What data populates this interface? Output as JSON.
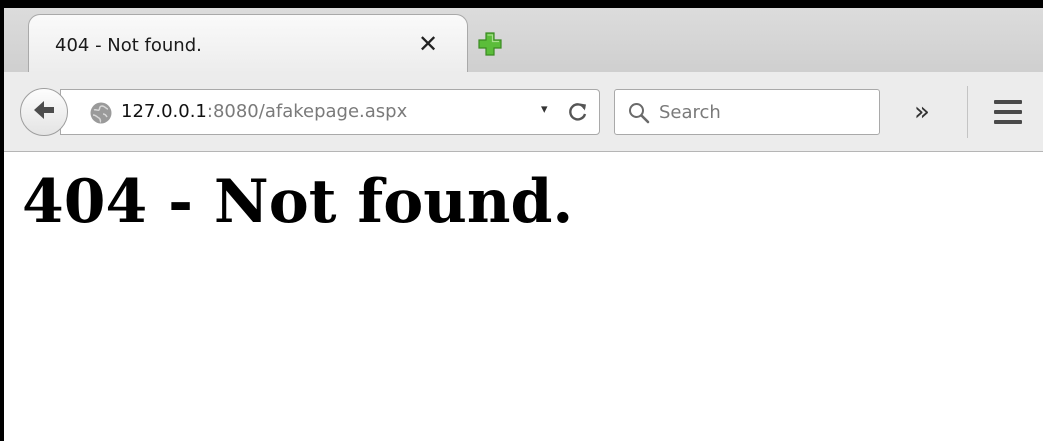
{
  "tab": {
    "title": "404 - Not found.",
    "close_glyph": "✕"
  },
  "newtab": {
    "icon": "green-plus-icon",
    "color": "#5bbd3a"
  },
  "navbar": {
    "url_host": "127.0.0.1",
    "url_rest": ":8080/afakepage.aspx",
    "url_dropdown_glyph": "▾",
    "search_placeholder": "Search",
    "overflow_glyph": "»"
  },
  "page": {
    "heading": "404 - Not found."
  }
}
